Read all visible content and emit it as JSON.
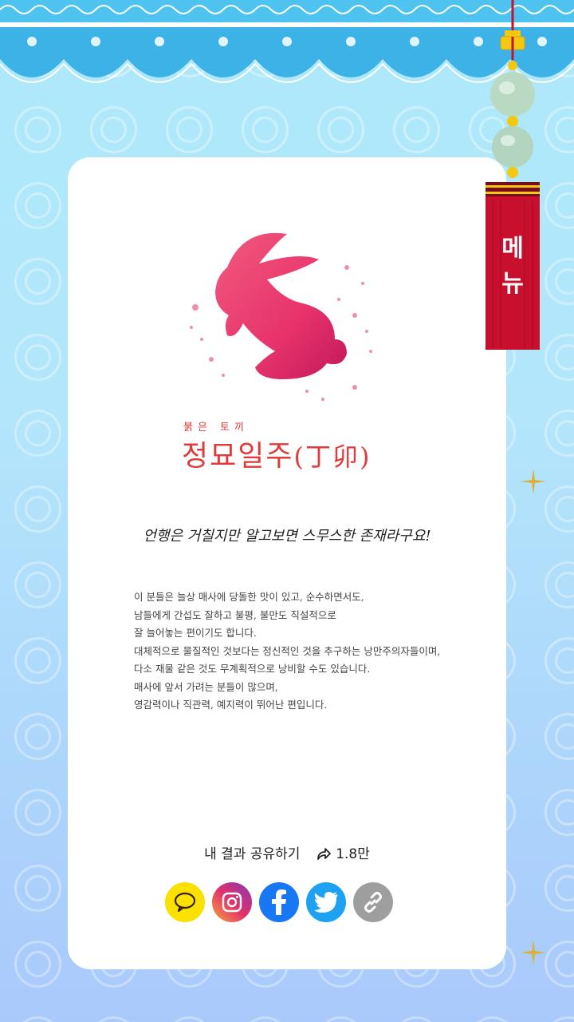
{
  "result": {
    "subtitle": "붉은 토끼",
    "title": "정묘일주",
    "title_hanja": "(丁卯)",
    "quote": "언행은 거칠지만 알고보면 스무스한 존재라구요!",
    "description": [
      "이 분들은 늘상 매사에 당돌한 맛이 있고, 순수하면서도,",
      "남들에게 간섭도 잘하고 불평, 불만도 직설적으로",
      "잘 늘어놓는 편이기도 합니다.",
      "대체적으로 물질적인 것보다는 정신적인 것을 추구하는 낭만주의자들이며,",
      "다소 재물 같은 것도 무계획적으로 낭비할 수도 있습니다.",
      "매사에 앞서 가려는 분들이 많으며,",
      "영감력이나 직관력, 예지력이 뛰어난 편입니다."
    ]
  },
  "menu": {
    "label_line1": "메",
    "label_line2": "뉴"
  },
  "share": {
    "label": "내 결과 공유하기",
    "count": "1.8만",
    "buttons": [
      {
        "name": "kakaotalk",
        "color": "#fae100",
        "icon": "speech-bubble-icon"
      },
      {
        "name": "instagram",
        "color": "#d6249f",
        "icon": "instagram-icon"
      },
      {
        "name": "facebook",
        "color": "#1877f2",
        "icon": "facebook-icon"
      },
      {
        "name": "twitter",
        "color": "#1da1f2",
        "icon": "twitter-icon"
      },
      {
        "name": "copy-link",
        "color": "#9e9e9e",
        "icon": "link-icon"
      }
    ]
  },
  "colors": {
    "title": "#e23a3a",
    "menu": "#c8102e",
    "accent": "#8bd6f3"
  }
}
